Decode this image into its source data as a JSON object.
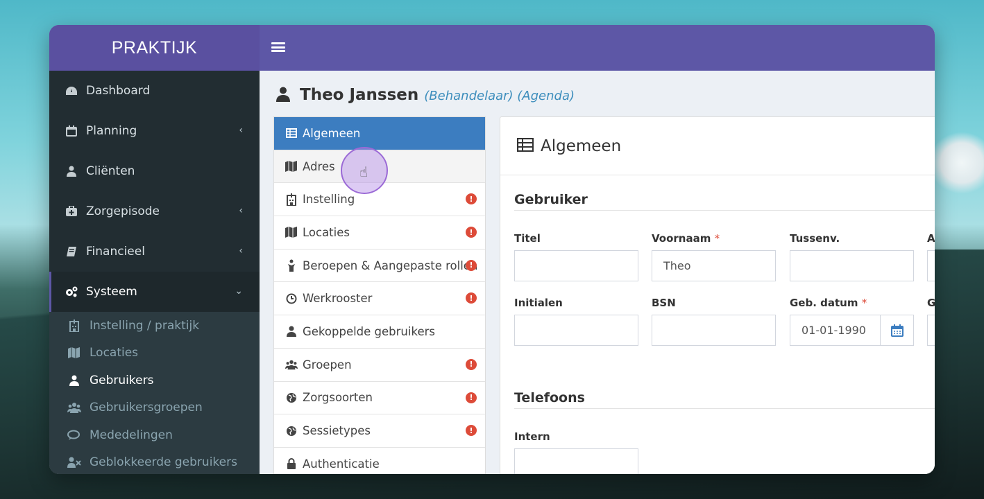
{
  "brand": "PRAKTIJK",
  "sidebar": {
    "items": [
      {
        "label": "Dashboard"
      },
      {
        "label": "Planning"
      },
      {
        "label": "Cliënten"
      },
      {
        "label": "Zorgepisode"
      },
      {
        "label": "Financieel"
      },
      {
        "label": "Systeem"
      }
    ],
    "sub_items": [
      {
        "label": "Instelling / praktijk"
      },
      {
        "label": "Locaties"
      },
      {
        "label": "Gebruikers"
      },
      {
        "label": "Gebruikersgroepen"
      },
      {
        "label": "Mededelingen"
      },
      {
        "label": "Geblokkeerde gebruikers"
      }
    ]
  },
  "header": {
    "name": "Theo Janssen",
    "roles": "(Behandelaar) (Agenda)"
  },
  "tabs": [
    {
      "label": "Algemeen",
      "warn": ""
    },
    {
      "label": "Adres",
      "warn": ""
    },
    {
      "label": "Instelling",
      "warn": "!"
    },
    {
      "label": "Locaties",
      "warn": "!"
    },
    {
      "label": "Beroepen & Aangepaste rollen",
      "warn": "!"
    },
    {
      "label": "Werkrooster",
      "warn": "!"
    },
    {
      "label": "Gekoppelde gebruikers",
      "warn": ""
    },
    {
      "label": "Groepen",
      "warn": "!"
    },
    {
      "label": "Zorgsoorten",
      "warn": "!"
    },
    {
      "label": "Sessietypes",
      "warn": "!"
    },
    {
      "label": "Authenticatie",
      "warn": ""
    }
  ],
  "panel": {
    "title": "Algemeen",
    "section_user": "Gebruiker",
    "section_phones": "Telefoons",
    "fields": {
      "titel": {
        "label": "Titel",
        "value": ""
      },
      "voornaam": {
        "label": "Voornaam",
        "required": "*",
        "value": "Theo"
      },
      "tussenv": {
        "label": "Tussenv.",
        "value": ""
      },
      "a_cut": {
        "label": "A",
        "value": ""
      },
      "initialen": {
        "label": "Initialen",
        "value": ""
      },
      "bsn": {
        "label": "BSN",
        "value": ""
      },
      "geb_datum": {
        "label": "Geb. datum",
        "required": "*",
        "value": "01-01-1990"
      },
      "g_cut": {
        "label": "G",
        "value": ""
      },
      "intern": {
        "label": "Intern",
        "value": ""
      }
    }
  },
  "colors": {
    "brand": "#5d57a6",
    "tab_active": "#3c7dc0",
    "warn": "#dd4b39",
    "sidebar": "#222d32"
  }
}
